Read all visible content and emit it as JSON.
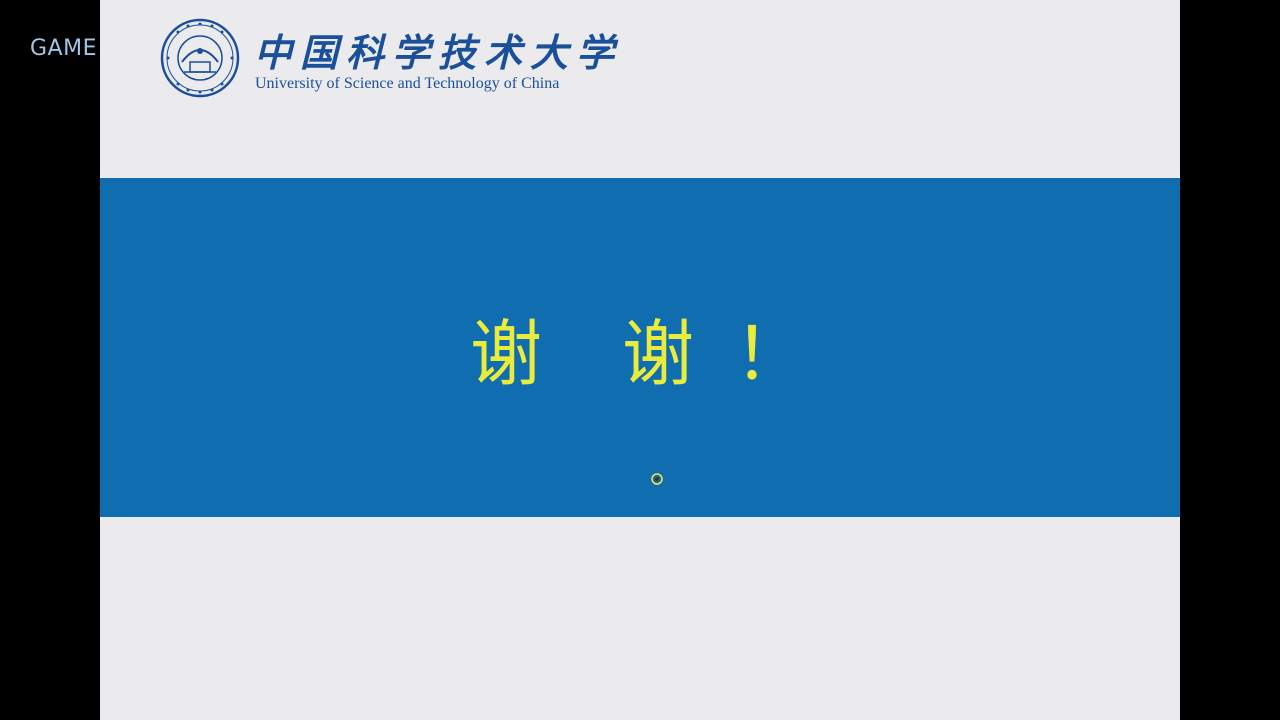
{
  "overlay": {
    "tag": "GAME"
  },
  "logo": {
    "name_cn": "中国科学技术大学",
    "name_en": "University of Science and Technology of China"
  },
  "slide": {
    "char1": "谢",
    "char2": "谢",
    "mark": "！"
  },
  "colors": {
    "outer_background": "#000000",
    "slide_background": "#ebebed",
    "band": "#0f6db0",
    "title_text": "#e9ec3c",
    "logo": "#1a4f9a"
  }
}
